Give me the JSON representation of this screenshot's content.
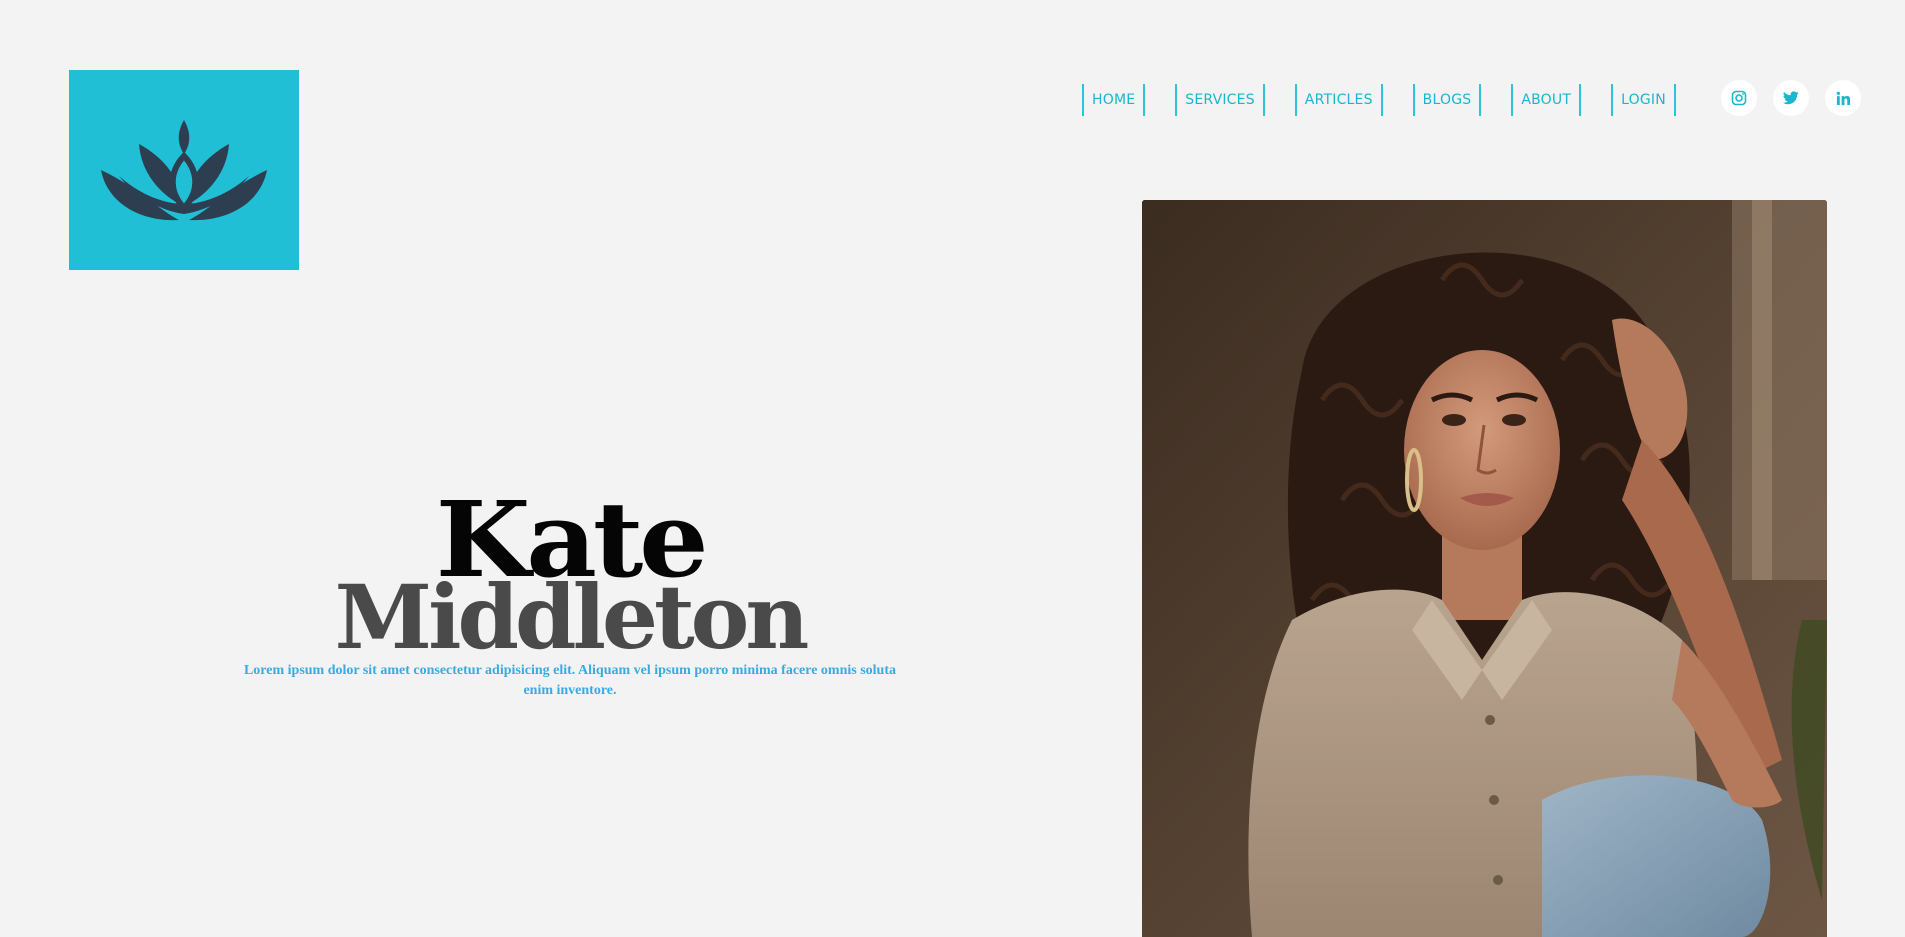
{
  "brand": {
    "logo_icon": "lotus-icon",
    "logo_bg": "#21bfd6",
    "logo_fg": "#2a3a4a"
  },
  "nav": {
    "items": [
      {
        "label": "HOME"
      },
      {
        "label": "SERVICES"
      },
      {
        "label": "ARTICLES"
      },
      {
        "label": "BLOGS"
      },
      {
        "label": "ABOUT"
      },
      {
        "label": "LOGIN"
      }
    ],
    "color": "#19b7cf"
  },
  "socials": [
    {
      "icon": "instagram-icon"
    },
    {
      "icon": "twitter-icon"
    },
    {
      "icon": "linkedin-icon"
    }
  ],
  "hero": {
    "first_name": "Kate",
    "last_name": "Middleton",
    "tagline": "Lorem ipsum dolor sit amet consectetur adipisicing elit. Aliquam vel ipsum porro minima facere omnis soluta enim inventore."
  },
  "photo": {
    "subject": "portrait-photo"
  }
}
